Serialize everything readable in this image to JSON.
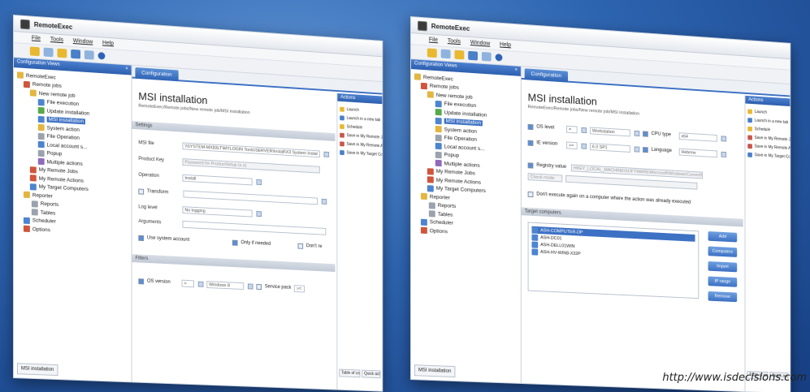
{
  "app_title": "RemoteExec",
  "menu": [
    "File",
    "Tools",
    "Window",
    "Help"
  ],
  "tree_header": "Configuration Views",
  "tree": [
    {
      "label": "RemoteExec",
      "icon": "fold"
    },
    {
      "label": "Remote jobs",
      "icon": "red"
    },
    {
      "label": "New remote job",
      "icon": "fold"
    },
    {
      "label": "File execution",
      "icon": "blue"
    },
    {
      "label": "Update installation",
      "icon": "green"
    },
    {
      "label": "MSI installation",
      "icon": "blue"
    },
    {
      "label": "System action",
      "icon": "fold"
    },
    {
      "label": "File Operation",
      "icon": "gray"
    },
    {
      "label": "Local account s...",
      "icon": "blue"
    },
    {
      "label": "Popup",
      "icon": "gray"
    },
    {
      "label": "Multiple actions",
      "icon": "purple"
    },
    {
      "label": "My Remote Jobs",
      "icon": "red"
    },
    {
      "label": "My Remote Actions",
      "icon": "red"
    },
    {
      "label": "My Target Computers",
      "icon": "blue"
    },
    {
      "label": "Reporter",
      "icon": "fold"
    },
    {
      "label": "Reports",
      "icon": "gray"
    },
    {
      "label": "Tables",
      "icon": "gray"
    },
    {
      "label": "Scheduler",
      "icon": "blue"
    },
    {
      "label": "Options",
      "icon": "red"
    }
  ],
  "status_tab": "MSI installation",
  "tab_label": "Configuration",
  "page_title": "MSI installation",
  "page_path": "RemoteExec/Remote jobs/New remote job/MSI installation",
  "left": {
    "section_settings": "Settings",
    "msi_file_label": "MSI file",
    "msi_file_value": "\\\\SYSTEM-MX83LT\\MYLOGIN Tools\\SERVER\\Install\\X3 System Instal",
    "product_key_label": "Product Key",
    "product_key_placeholder": "Password for ProductSetup (x.x)",
    "operation_label": "Operation",
    "operation_value": "Install",
    "transform_label": "Transform",
    "log_level_label": "Log level",
    "log_level_value": "No logging",
    "arguments_label": "Arguments",
    "use_system_account": "Use system account",
    "only_if_needed": "Only if needed",
    "dont_reboot": "Don't re",
    "section_filters": "Filters",
    "os_version_label": "OS version",
    "os_op": "=",
    "os_value": "Windows 8",
    "service_pack_label": "Service pack",
    "service_pack_op": ">="
  },
  "right": {
    "os_level_label": "OS level",
    "os_level_op": "=",
    "os_level_value": "Workstation",
    "cpu_type_label": "CPU type",
    "cpu_type_value": "x64",
    "ie_version_label": "IE version",
    "ie_version_op": ">=",
    "ie_version_value": "6.0 SP1",
    "language_label": "Language",
    "language_value": "Hebrew",
    "registry_label": "Registry value",
    "registry_value": "HKEY_LOCAL_MACHINE\\SOFTWARE\\Microsoft\\Windows\\CurrentVersion",
    "version_value": "Check mode",
    "dont_execute_again": "Don't execute again on a computer where the action was already executed",
    "section_targets": "Target computers",
    "computers": [
      "ASH-COMPUTER-DP",
      "ASH-DC01",
      "ASH-DELL01WIN",
      "ASH-HV-WIN8-X32P"
    ],
    "buttons": [
      "Add",
      "Computers",
      "Import",
      "IP range",
      "Remove"
    ]
  },
  "actions_header": "Actions",
  "actions": [
    {
      "label": "Launch",
      "icon": "y"
    },
    {
      "label": "Launch in a new tab",
      "icon": "b"
    },
    {
      "label": "Schedule",
      "icon": "y"
    },
    {
      "label": "Save in My Remote Jobs",
      "icon": "r"
    },
    {
      "label": "Save in My Remote Actions",
      "icon": "r"
    },
    {
      "label": "Save in My Target Computers",
      "icon": "b"
    }
  ],
  "footer_tabs": [
    "Table of content",
    "Quick actions"
  ],
  "url": "http://www.isdecisions.com"
}
